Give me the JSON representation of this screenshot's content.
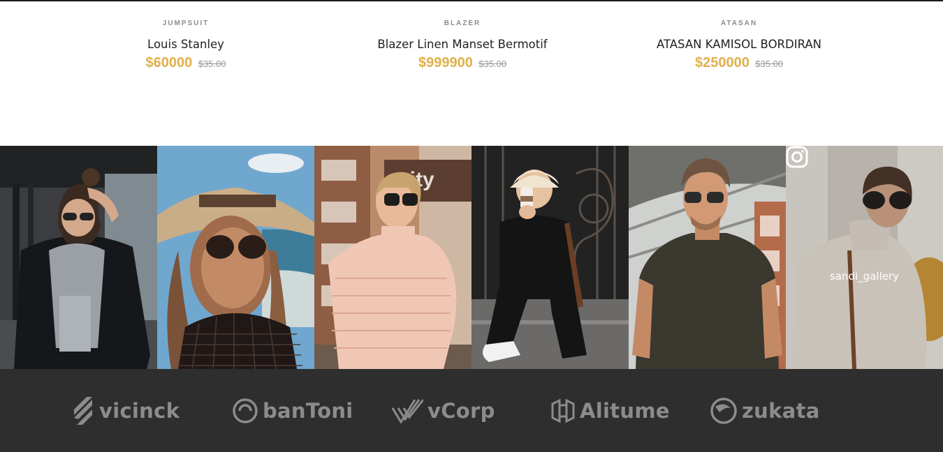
{
  "products": [
    {
      "category": "JUMPSUIT",
      "name": "Louis Stanley",
      "price": "$60000",
      "old_price": "$35.00"
    },
    {
      "category": "BLAZER",
      "name": "Blazer Linen Manset Bermotif",
      "price": "$999900",
      "old_price": "$35.00"
    },
    {
      "category": "ATASAN",
      "name": "ATASAN KAMISOL BORDIRAN",
      "price": "$250000",
      "old_price": "$35.00"
    }
  ],
  "instagram": {
    "handle": "sandi_gallery",
    "icon": "instagram-icon"
  },
  "brands": [
    {
      "name": "vicinck",
      "icon": "vicinck-logo-icon"
    },
    {
      "name": "banToni",
      "icon": "bantoni-logo-icon"
    },
    {
      "name": "vCorp",
      "icon": "vcorp-logo-icon"
    },
    {
      "name": "Alitume",
      "icon": "alitume-logo-icon"
    },
    {
      "name": "zukata",
      "icon": "zukata-logo-icon"
    }
  ],
  "colors": {
    "price": "#e0b04a",
    "footer_bg": "#2e2e2e",
    "brand_text": "#8c8c8c"
  }
}
